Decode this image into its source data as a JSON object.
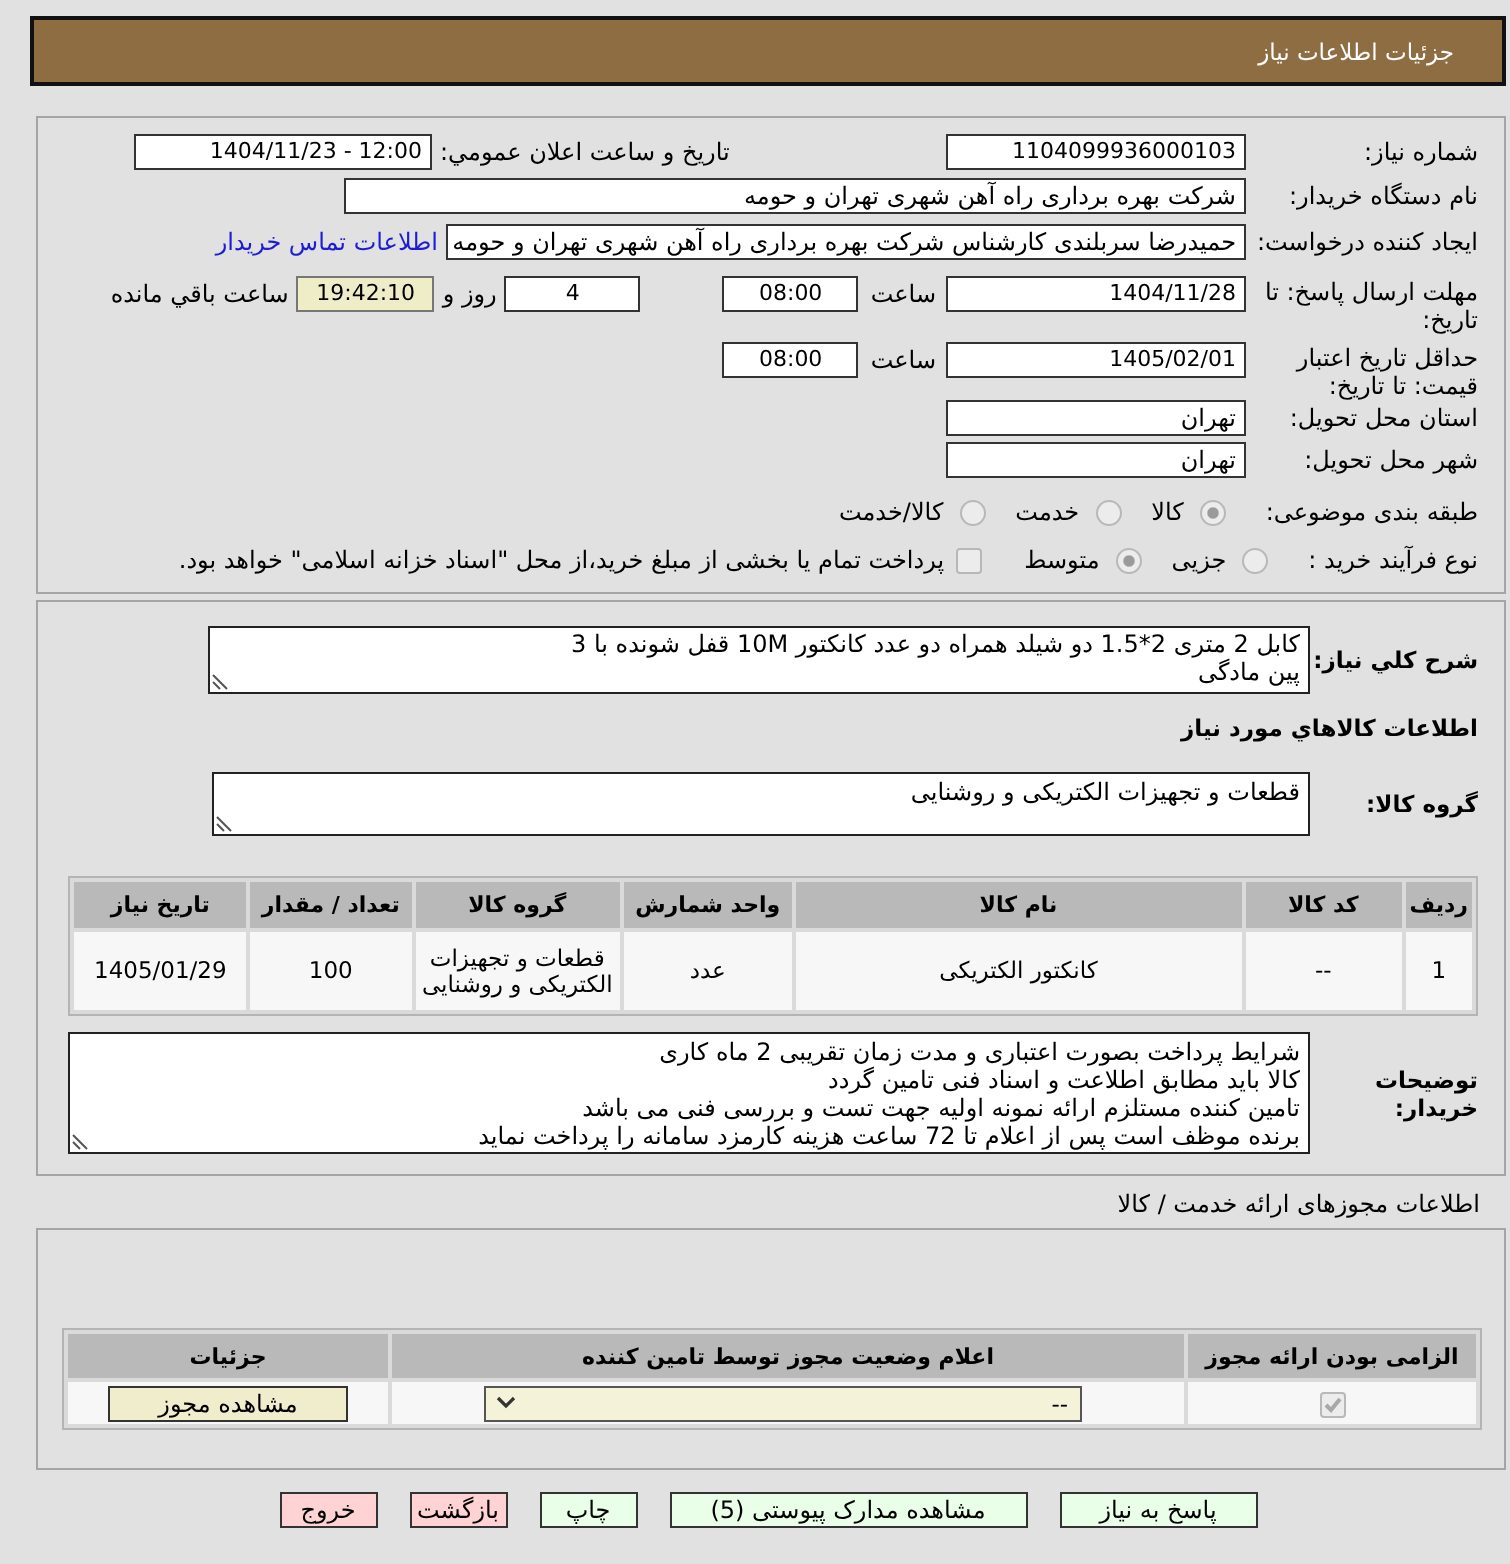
{
  "header": {
    "title": "جزئیات اطلاعات نیاز"
  },
  "details": {
    "need_number": {
      "label": "شماره نیاز:",
      "value": "1104099936000103"
    },
    "announcement": {
      "label": "تاریخ و ساعت اعلان عمومي:",
      "value": "1404/11/23 - 12:00"
    },
    "buyer_org": {
      "label": "نام دستگاه خریدار:",
      "value": "شرکت بهره برداری راه آهن شهری تهران و حومه"
    },
    "requester": {
      "label": "ایجاد کننده درخواست:",
      "value": "حمیدرضا سربلندی کارشناس شرکت بهره برداری راه آهن شهری تهران و حومه",
      "link": "اطلاعات تماس خریدار"
    },
    "response_deadline": {
      "label": "مهلت ارسال پاسخ: تا تاریخ:",
      "date": "1404/11/28",
      "time_label": "ساعت",
      "time": "08:00",
      "days": "4",
      "days_label": "روز و",
      "remaining": "19:42:10",
      "remaining_label": "ساعت باقي مانده"
    },
    "price_validity": {
      "label": "حداقل تاریخ اعتبار قیمت: تا تاریخ:",
      "date": "1405/02/01",
      "time_label": "ساعت",
      "time": "08:00"
    },
    "province": {
      "label": "استان محل تحویل:",
      "value": "تهران"
    },
    "city": {
      "label": "شهر محل تحویل:",
      "value": "تهران"
    },
    "category": {
      "label": "طبقه بندی موضوعی:",
      "options": [
        {
          "label": "کالا",
          "selected": true
        },
        {
          "label": "خدمت",
          "selected": false
        },
        {
          "label": "کالا/خدمت",
          "selected": false
        }
      ]
    },
    "purchase_type": {
      "label": "نوع فرآیند خرید :",
      "options": [
        {
          "label": "جزیی",
          "selected": false
        },
        {
          "label": "متوسط",
          "selected": true
        }
      ],
      "treasury": {
        "label": "پرداخت تمام یا بخشی از مبلغ خرید،از محل \"اسناد خزانه اسلامی\" خواهد بود.",
        "checked": false
      }
    }
  },
  "need": {
    "description": {
      "label": "شرح کلي نیاز:",
      "value": "کابل 2 متری 2*1.5 دو شیلد همراه دو عدد کانکتور 10M قفل شونده با 3\nپین مادگی"
    },
    "goods_heading": "اطلاعات کالاهاي مورد نیاز",
    "goods_group": {
      "label": "گروه کالا:",
      "value": "قطعات و تجهیزات الکتریکی و روشنایی"
    },
    "goods_table": {
      "columns": [
        "ردیف",
        "کد کالا",
        "نام کالا",
        "واحد شمارش",
        "گروه کالا",
        "تعداد / مقدار",
        "تاریخ نیاز"
      ],
      "rows": [
        [
          "1",
          "--",
          "کانکتور الکتریکی",
          "عدد",
          "قطعات و تجهیزات الکتریکی و روشنایی",
          "100",
          "1405/01/29"
        ]
      ]
    },
    "buyer_notes": {
      "label": "توضیحات خریدار:",
      "lines": [
        "شرایط پرداخت بصورت اعتباری و مدت زمان تقریبی 2 ماه کاری",
        "کالا باید مطابق اطلاعت و اسناد فنی تامین گردد",
        "تامین کننده مستلزم ارائه نمونه اولیه جهت تست و بررسی فنی می باشد",
        "برنده موظف است پس از اعلام  تا 72 ساعت هزینه کارمزد سامانه را پرداخت نماید"
      ]
    }
  },
  "licenses": {
    "title": "اطلاعات مجوزهای ارائه خدمت / کالا",
    "columns": [
      "الزامی بودن ارائه مجوز",
      "اعلام وضعیت مجوز توسط تامین کننده",
      "جزئیات"
    ],
    "rows": [
      {
        "checked": true,
        "status": "--",
        "button": "مشاهده مجوز"
      }
    ]
  },
  "actions": [
    {
      "label": "پاسخ به نیاز",
      "kind": "reply"
    },
    {
      "label": "مشاهده مدارک پیوستی (5)",
      "kind": "documents"
    },
    {
      "label": "چاپ",
      "kind": "print"
    },
    {
      "label": "بازگشت",
      "kind": "back"
    },
    {
      "label": "خروج",
      "kind": "exit"
    }
  ]
}
